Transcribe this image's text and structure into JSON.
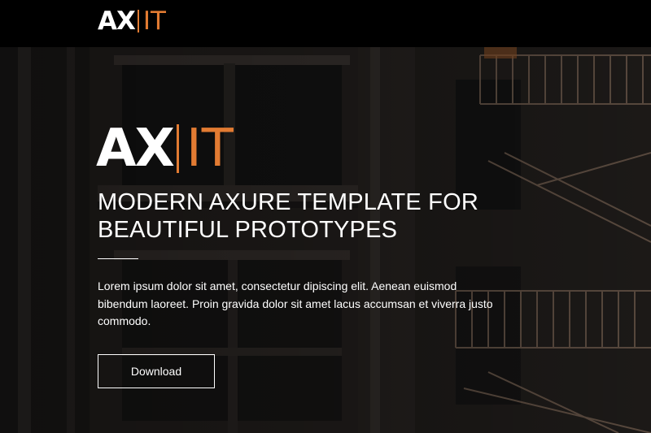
{
  "navbar": {
    "logo": {
      "part_a": "AX",
      "part_b": "IT"
    }
  },
  "hero": {
    "logo": {
      "part_a": "AX",
      "part_b": "IT"
    },
    "headline": "MODERN AXURE TEMPLATE FOR BEAUTIFUL PROTOTYPES",
    "description": "Lorem ipsum dolor sit amet, consectetur dipiscing elit. Aenean euismod bibendum laoreet. Proin gravida dolor sit amet lacus accumsan et viverra justo commodo.",
    "download_label": "Download"
  },
  "colors": {
    "accent": "#e27b32",
    "navbar_background": "#000000",
    "text": "#ffffff"
  }
}
